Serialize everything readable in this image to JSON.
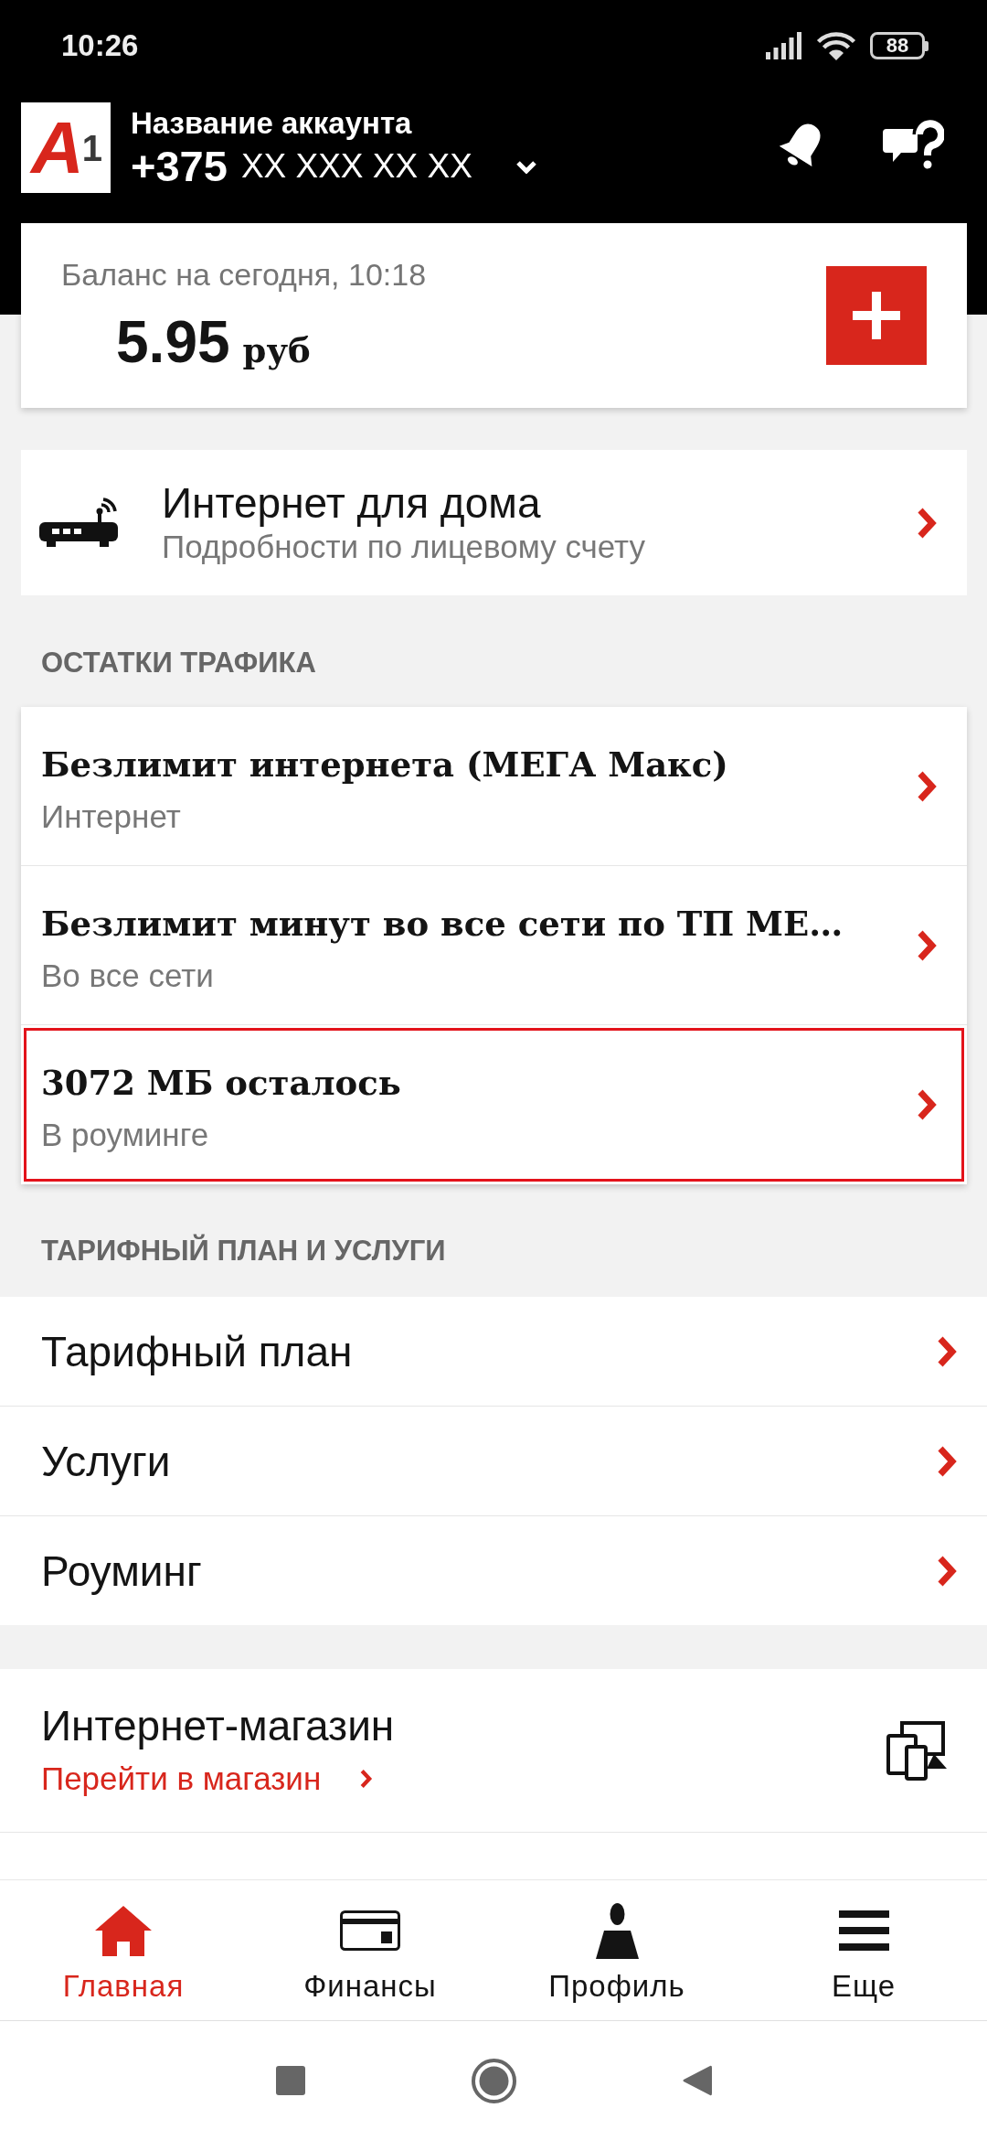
{
  "status_bar": {
    "time": "10:26",
    "battery": "88"
  },
  "header": {
    "logo": "A$^{1}$",
    "account_name": "Название аккаунта",
    "phone_code": "+375",
    "phone_number": "XX XXX XX XX"
  },
  "balance": {
    "label": "Баланс на сегодня, 10:18",
    "amount": "5.95",
    "currency": "руб"
  },
  "home_internet": {
    "title": "Интернет для дома",
    "subtitle": "Подробности по лицевому счету"
  },
  "traffic": {
    "heading": "ОСТАТКИ ТРАФИКА",
    "items": [
      {
        "title": "Безлимит интернета (МЕГА Макс)",
        "subtitle": "Интернет",
        "selected": false
      },
      {
        "title": "Безлимит минут во все сети по ТП МЕ…",
        "subtitle": "Во все сети",
        "selected": false
      },
      {
        "title": "3072 МБ осталось",
        "subtitle": "В роуминге",
        "selected": true
      }
    ]
  },
  "services": {
    "heading": "ТАРИФНЫЙ ПЛАН И УСЛУГИ",
    "items": [
      "Тарифный план",
      "Услуги",
      "Роуминг"
    ]
  },
  "shop": {
    "title": "Интернет-магазин",
    "link": "Перейти в магазин"
  },
  "bottom_nav": [
    {
      "label": "Главная",
      "selected": true
    },
    {
      "label": "Финансы",
      "selected": false
    },
    {
      "label": "Профиль",
      "selected": false
    },
    {
      "label": "Еще",
      "selected": false
    }
  ]
}
